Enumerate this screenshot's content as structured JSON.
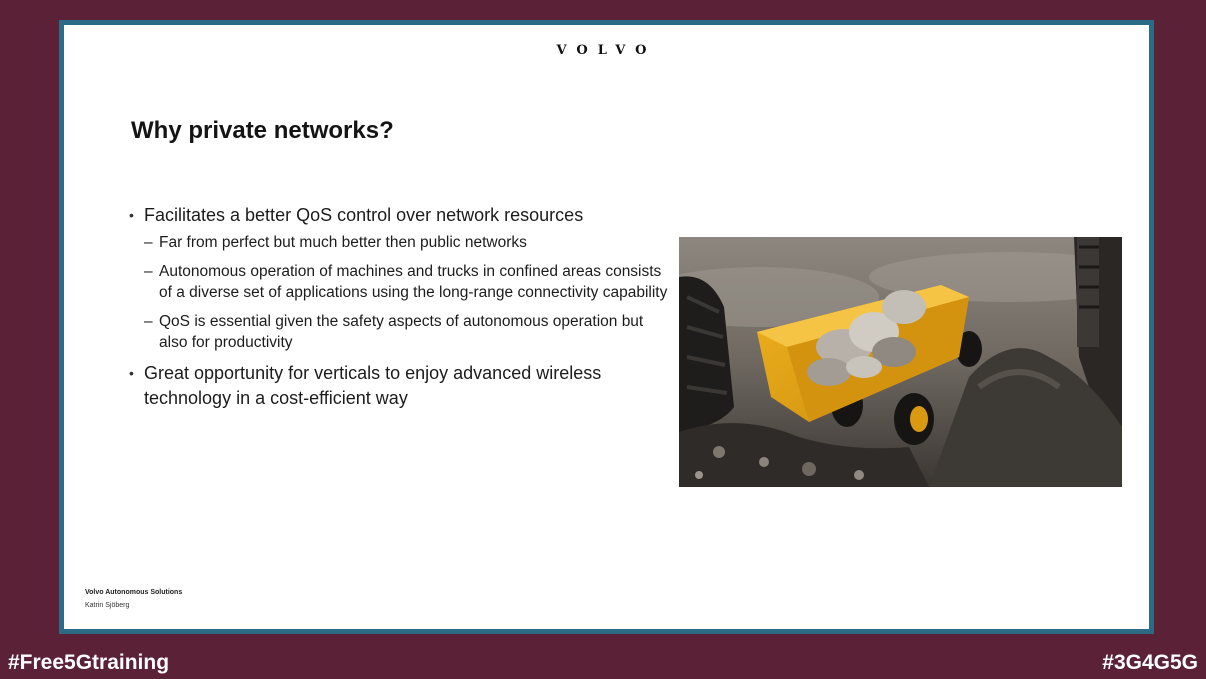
{
  "slide": {
    "logo": "VOLVO",
    "title": "Why private networks?",
    "bullets": [
      {
        "text": "Facilitates a better QoS control over network resources",
        "subs": [
          "Far from perfect but much better then public networks",
          "Autonomous operation of machines and trucks in confined areas consists of a diverse set of applications using the long-range connectivity capability",
          "QoS is essential given the safety aspects of autonomous operation but also for productivity"
        ]
      },
      {
        "text": "Great opportunity for verticals to enjoy advanced wireless technology in a cost-efficient way",
        "subs": []
      }
    ],
    "footer_company": "Volvo Autonomous Solutions",
    "footer_author": "Katrin Sjöberg",
    "bullet_marker": "•",
    "sub_marker": "–"
  },
  "hashtags": {
    "left": "#Free5Gtraining",
    "right": "#3G4G5G"
  },
  "colors": {
    "background": "#5b2136",
    "frame": "#2b6b86",
    "slide": "#ffffff",
    "truck_bed": "#e8a717"
  }
}
